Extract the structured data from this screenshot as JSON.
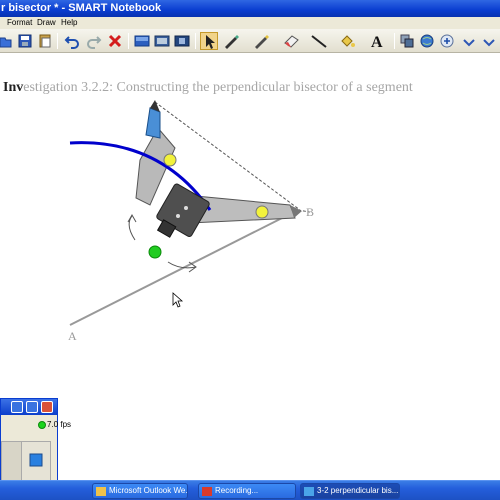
{
  "window": {
    "title": "r bisector * - SMART Notebook"
  },
  "menu": [
    "Format",
    "Draw",
    "Help"
  ],
  "toolbar": {
    "icons": [
      "open-icon",
      "save-icon",
      "paste-icon",
      "undo-icon",
      "redo-icon",
      "delete-icon",
      "screen-shade-icon",
      "display-icon",
      "capture-icon",
      "select-icon",
      "pen-icon",
      "creative-pen-icon",
      "eraser-icon",
      "line-icon",
      "fill-icon",
      "text-icon",
      "properties-icon",
      "globe-icon",
      "more-icon"
    ],
    "selected": "select-icon"
  },
  "page": {
    "title_bold": "Inv",
    "title_rest": "estigation 3.2.2: Constructing the perpendicular bisector of a segment",
    "label_a": "A",
    "label_b": "B"
  },
  "colors": {
    "arc": "#0000cc",
    "segment": "#999999",
    "pivot": "#f2f23c",
    "handle": "#22cc22"
  },
  "recorder": {
    "fps": "7.0 fps"
  },
  "taskbar": {
    "tasks": [
      "Microsoft Outlook We...",
      "Recording...",
      "3-2 perpendicular bis..."
    ]
  }
}
